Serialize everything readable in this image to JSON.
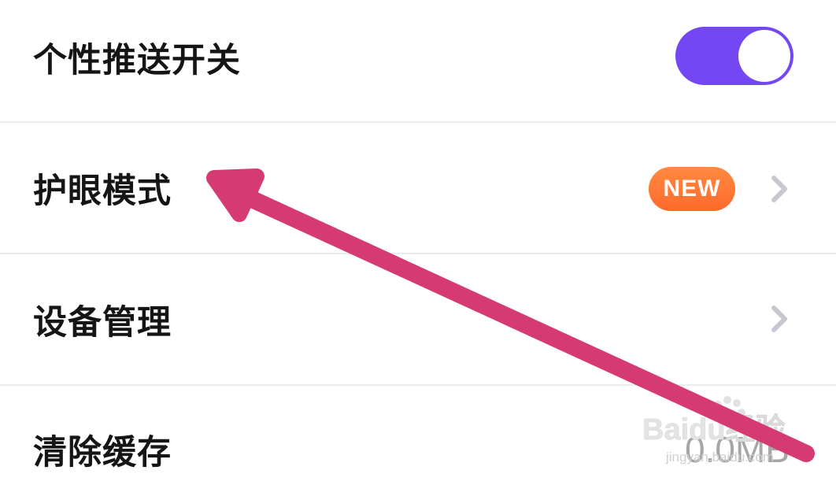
{
  "settings": {
    "items": [
      {
        "label": "个性推送开关",
        "control": "toggle",
        "toggle_on": true
      },
      {
        "label": "护眼模式",
        "badge": "NEW",
        "control": "chevron"
      },
      {
        "label": "设备管理",
        "control": "chevron"
      },
      {
        "label": "清除缓存",
        "value": "0.0MB"
      }
    ]
  },
  "colors": {
    "toggle_on": "#7348f2",
    "badge_start": "#ff8a40",
    "badge_end": "#ff6a2c",
    "chevron": "#c7c7d1",
    "divider": "#ececef",
    "annotation_arrow": "#d63a72",
    "value_text": "#a6a6a6"
  },
  "icons": {
    "chevron": "chevron-right-icon",
    "annotation": "arrow-annotation-icon"
  },
  "watermark": {
    "brand": "Baidu经验",
    "url": "jingyan.baidu.com"
  }
}
